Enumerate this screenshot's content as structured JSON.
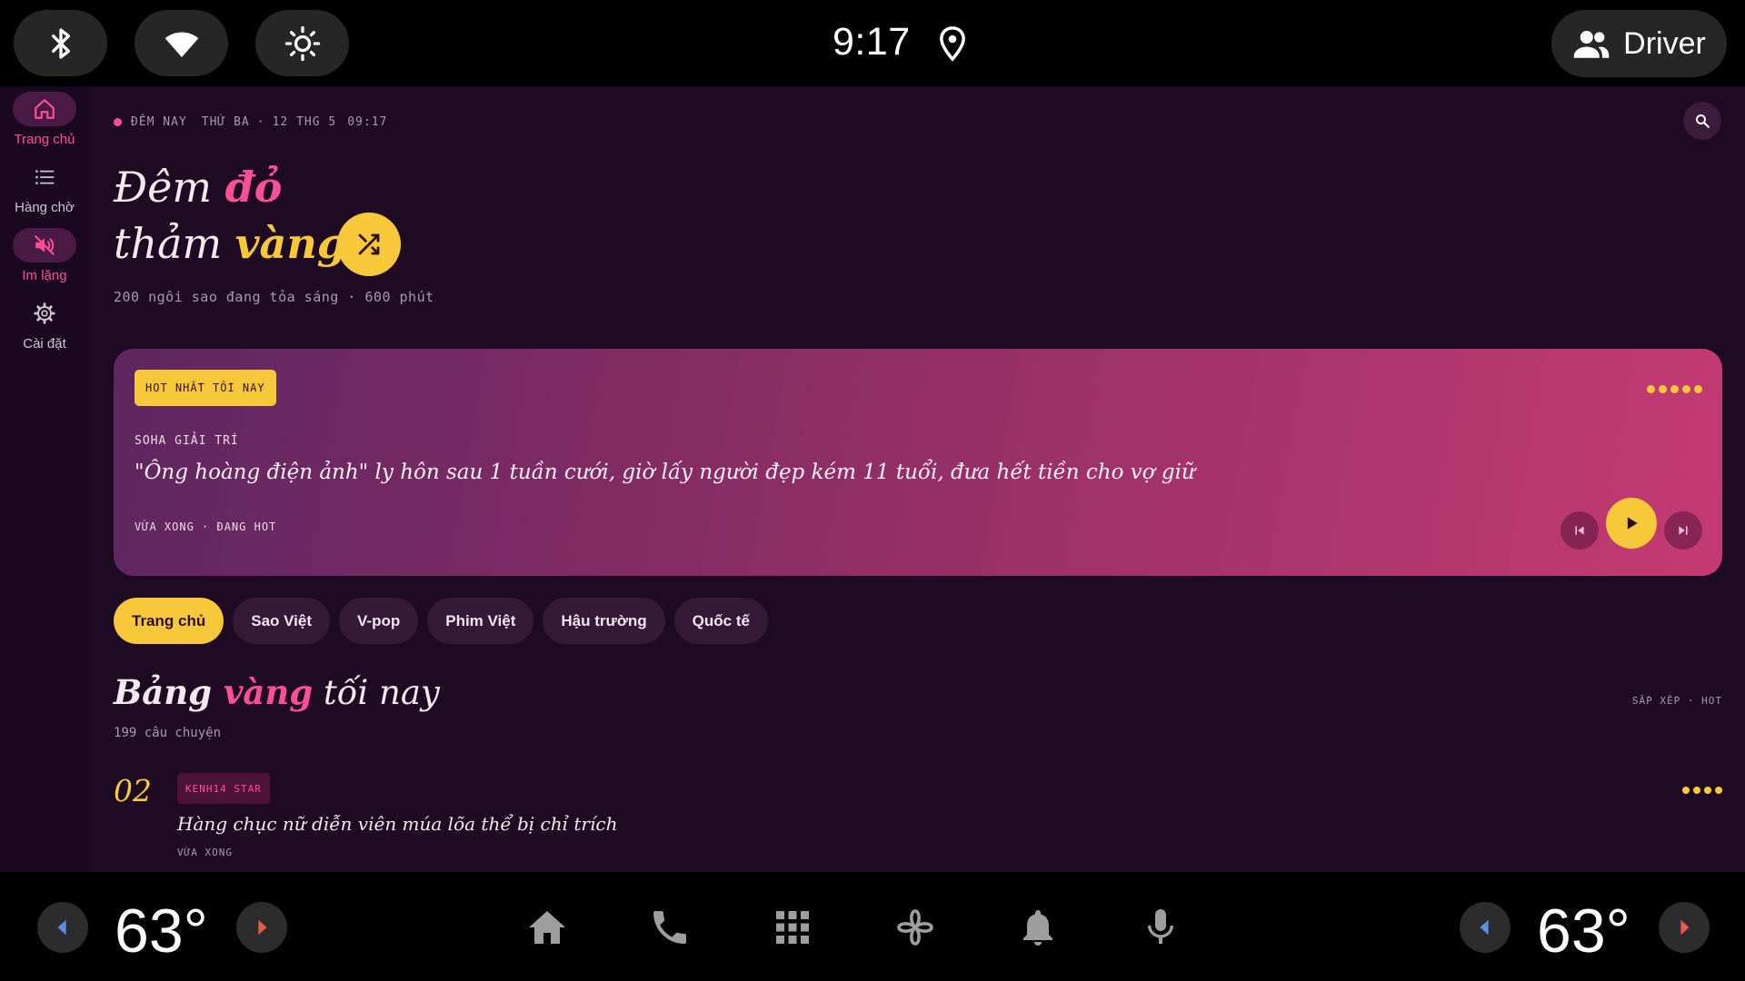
{
  "status_bar": {
    "icons": [
      "bluetooth-icon",
      "wifi-icon",
      "brightness-icon"
    ],
    "time": "9:17",
    "location_icon": "location-pin-icon",
    "profile_label": "Driver",
    "profile_icon": "people-icon"
  },
  "nav_rail": {
    "items": [
      {
        "label": "Trang chủ",
        "icon": "home-icon",
        "active": true
      },
      {
        "label": "Hàng chờ",
        "icon": "queue-list-icon",
        "active": false
      },
      {
        "label": "Im lặng",
        "icon": "mute-icon",
        "active": true
      },
      {
        "label": "Cài đặt",
        "icon": "settings-gear-icon",
        "active": false
      }
    ]
  },
  "header": {
    "live_label": "ĐÊM NAY",
    "day": "THỨ BA",
    "separator": "·",
    "date": "12 THG 5",
    "time": "09:17",
    "search_icon": "search-icon"
  },
  "hero": {
    "line1_a": "Đêm ",
    "line1_b": "đỏ",
    "line2_a": "thảm ",
    "line2_b": "vàng",
    "subtitle": "200 ngôi sao đang tỏa sáng · 600 phút",
    "shuffle_icon": "shuffle-icon"
  },
  "featured": {
    "badge": "HOT NHẤT TỐI NAY",
    "source": "SOHA GIẢI TRÍ",
    "headline": "\"Ông hoàng điện ảnh\" ly hôn sau 1 tuần cưới, giờ lấy người đẹp kém 11 tuổi, đưa hết tiền cho vợ giữ",
    "meta": "VỪA XONG · ĐANG HOT",
    "rating_dots": 5,
    "controls": [
      "skip-previous-icon",
      "play-icon",
      "skip-next-icon"
    ]
  },
  "chips": [
    {
      "label": "Trang chủ",
      "active": true
    },
    {
      "label": "Sao Việt",
      "active": false
    },
    {
      "label": "V-pop",
      "active": false
    },
    {
      "label": "Phim Việt",
      "active": false
    },
    {
      "label": "Hậu trường",
      "active": false
    },
    {
      "label": "Quốc tế",
      "active": false
    }
  ],
  "section": {
    "title_a": "Bảng ",
    "title_b": "vàng",
    "title_c": " tối nay",
    "sort_label": "SẮP XẾP · HOT",
    "count": "199 câu chuyện"
  },
  "list": [
    {
      "rank": "02",
      "source": "KENH14 STAR",
      "title": "Hàng chục nữ diễn viên múa lõa thể bị chỉ trích",
      "meta": "VỪA XONG",
      "rating_dots": 4
    }
  ],
  "bottom_bar": {
    "left_temp": "63°",
    "right_temp": "63°",
    "dock": [
      "home-icon",
      "phone-icon",
      "app-grid-icon",
      "fan-icon",
      "bell-icon",
      "microphone-icon"
    ]
  },
  "colors": {
    "accent_pink": "#ff4f96",
    "accent_gold": "#f7c83a",
    "background": "#1e0a23"
  }
}
